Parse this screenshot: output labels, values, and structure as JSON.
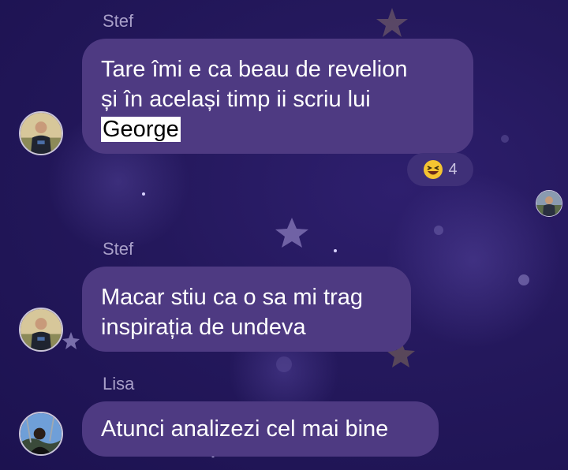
{
  "messages": [
    {
      "sender": "Stef",
      "lines": [
        "Tare îmi e ca beau de revelion",
        "și în același timp ii scriu lui"
      ],
      "mention": "George",
      "reaction": {
        "icon": "laughing-emoji-icon",
        "count": "4"
      }
    },
    {
      "sender": "Stef",
      "lines": [
        "Macar stiu ca o sa mi trag",
        "inspirația de undeva"
      ]
    },
    {
      "sender": "Lisa",
      "lines": [
        "Atunci analizezi cel mai bine"
      ]
    }
  ],
  "colors": {
    "background": "#24185c",
    "bubble": "#4e3a82",
    "sender_text": "#a89fc8",
    "mention_highlight": "#ffffff"
  }
}
